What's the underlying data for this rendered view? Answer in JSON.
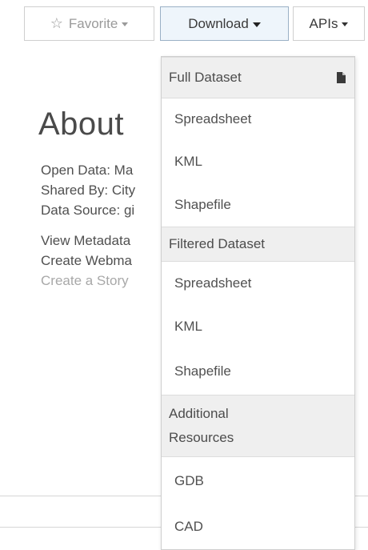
{
  "toolbar": {
    "favorite_label": "Favorite",
    "download_label": "Download",
    "apis_label": "APIs"
  },
  "about": {
    "title": "About",
    "lines": [
      "Open Data: Ma",
      "Shared By: City",
      "Data Source: gi"
    ],
    "links": [
      "View Metadata",
      "Create Webma",
      "Create a Story"
    ]
  },
  "download_menu": {
    "full_dataset_header": "Full Dataset",
    "full_items": [
      "Spreadsheet",
      "KML",
      "Shapefile"
    ],
    "filtered_dataset_header": "Filtered Dataset",
    "filtered_items": [
      "Spreadsheet",
      "KML",
      "Shapefile"
    ],
    "additional_header_line1": "Additional",
    "additional_header_line2": "Resources",
    "additional_items": [
      "GDB",
      "CAD"
    ]
  },
  "icons": {
    "favorite": "star-outline-icon",
    "dropdown": "caret-down-icon",
    "full_dataset": "file-icon"
  },
  "colors": {
    "active_button_bg": "#eef5fb",
    "active_button_border": "#9ab0c6",
    "menu_header_bg": "#efefef",
    "muted_text": "#a8a8a8"
  }
}
